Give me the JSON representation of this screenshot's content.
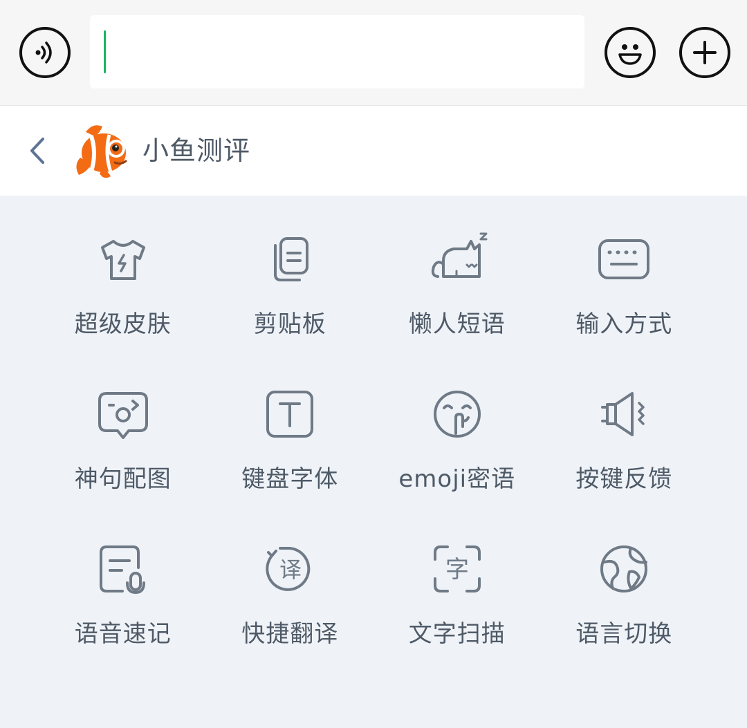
{
  "input": {
    "value": "",
    "placeholder": ""
  },
  "brand": {
    "name": "小鱼测评"
  },
  "features": [
    {
      "label": "超级皮肤",
      "icon": "tshirt-icon"
    },
    {
      "label": "剪贴板",
      "icon": "clipboard-icon"
    },
    {
      "label": "懒人短语",
      "icon": "sleeping-cat-icon"
    },
    {
      "label": "输入方式",
      "icon": "keyboard-icon"
    },
    {
      "label": "神句配图",
      "icon": "surprised-bubble-icon"
    },
    {
      "label": "键盘字体",
      "icon": "font-t-icon"
    },
    {
      "label": "emoji密语",
      "icon": "shush-emoji-icon"
    },
    {
      "label": "按键反馈",
      "icon": "speaker-vibration-icon"
    },
    {
      "label": "语音速记",
      "icon": "voice-note-icon"
    },
    {
      "label": "快捷翻译",
      "icon": "translate-icon"
    },
    {
      "label": "文字扫描",
      "icon": "text-scan-icon"
    },
    {
      "label": "语言切换",
      "icon": "globe-icon"
    }
  ],
  "colors": {
    "caret": "#18b566",
    "panel_background": "#eff3f8",
    "icon": "#6f7a86",
    "text": "#4f5a67"
  }
}
